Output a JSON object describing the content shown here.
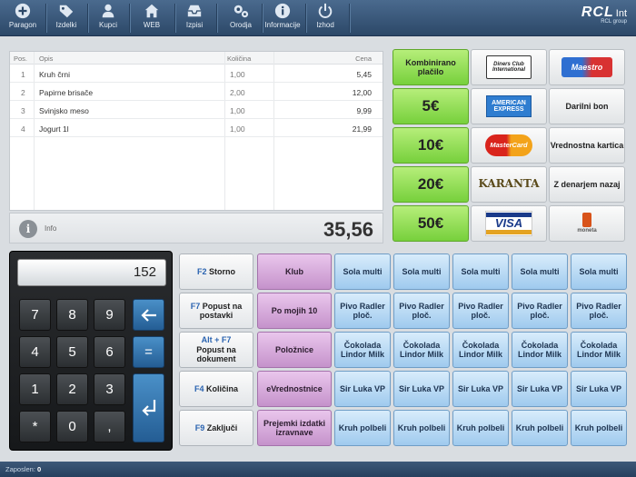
{
  "toolbar": {
    "items": [
      {
        "label": "Paragon",
        "icon": "plus-circle-icon"
      },
      {
        "label": "Izdelki",
        "icon": "tag-icon"
      },
      {
        "label": "Kupci",
        "icon": "user-icon"
      },
      {
        "label": "WEB",
        "icon": "home-icon"
      },
      {
        "label": "Izpisi",
        "icon": "inbox-icon"
      },
      {
        "label": "Orodja",
        "icon": "gears-icon"
      },
      {
        "label": "Informacije",
        "icon": "info-icon"
      },
      {
        "label": "Izhod",
        "icon": "power-icon"
      }
    ],
    "logo": {
      "brand": "RCL",
      "suffix": "Int",
      "sub": "RCL group"
    }
  },
  "receipt": {
    "headers": {
      "pos": "Pos.",
      "desc": "Opis",
      "qty": "Količina",
      "price": "Cena"
    },
    "rows": [
      {
        "pos": "1",
        "desc": "Kruh črni",
        "qty": "1,00",
        "price": "5,45"
      },
      {
        "pos": "2",
        "desc": "Papirne brisače",
        "qty": "2,00",
        "price": "12,00"
      },
      {
        "pos": "3",
        "desc": "Svinjsko meso",
        "qty": "1,00",
        "price": "9,99"
      },
      {
        "pos": "4",
        "desc": "Jogurt 1l",
        "qty": "1,00",
        "price": "21,99"
      }
    ],
    "info_label": "Info",
    "total": "35,56"
  },
  "payment": {
    "kombinirano": "Kombinirano plačilo",
    "diners_top": "Diners Club",
    "diners_bottom": "International",
    "maestro": "Maestro",
    "cash": [
      "5€",
      "10€",
      "20€",
      "50€"
    ],
    "amex_top": "AMERICAN",
    "amex_bottom": "EXPRESS",
    "mastercard": "MasterCard",
    "karanta": "KARANTA",
    "visa": "VISA",
    "moneta": "moneta",
    "darilni": "Darilni bon",
    "vrednostna": "Vrednostna kartica",
    "z_denarjem": "Z denarjem nazaj"
  },
  "keypad": {
    "display": "152",
    "keys": [
      "7",
      "8",
      "9",
      "4",
      "5",
      "6",
      "1",
      "2",
      "3",
      "*",
      "0",
      ","
    ],
    "equals": "="
  },
  "functions": {
    "storno": {
      "key": "F2",
      "label": "Storno"
    },
    "popust": {
      "key": "F7",
      "label": "Popust na postavki"
    },
    "popust_dok": {
      "key": "Alt + F7",
      "label": "Popust na dokument"
    },
    "kolicina": {
      "key": "F4",
      "label": "Količina"
    },
    "zakljuci": {
      "key": "F9",
      "label": "Zaključi"
    },
    "klub": "Klub",
    "po_mojih": "Po mojih 10",
    "poloznice": "Položnice",
    "evrednostnice": "eVrednostnice",
    "prejemki": "Prejemki izdatki izravnave"
  },
  "products": {
    "row1": "Sola multi",
    "row2": "Pivo Radler ploč.",
    "row3": "Čokolada Lindor Milk",
    "row4": "Sir Luka VP",
    "row5": "Kruh polbeli"
  },
  "status": {
    "label": "Zaposlen:",
    "value": "0"
  }
}
